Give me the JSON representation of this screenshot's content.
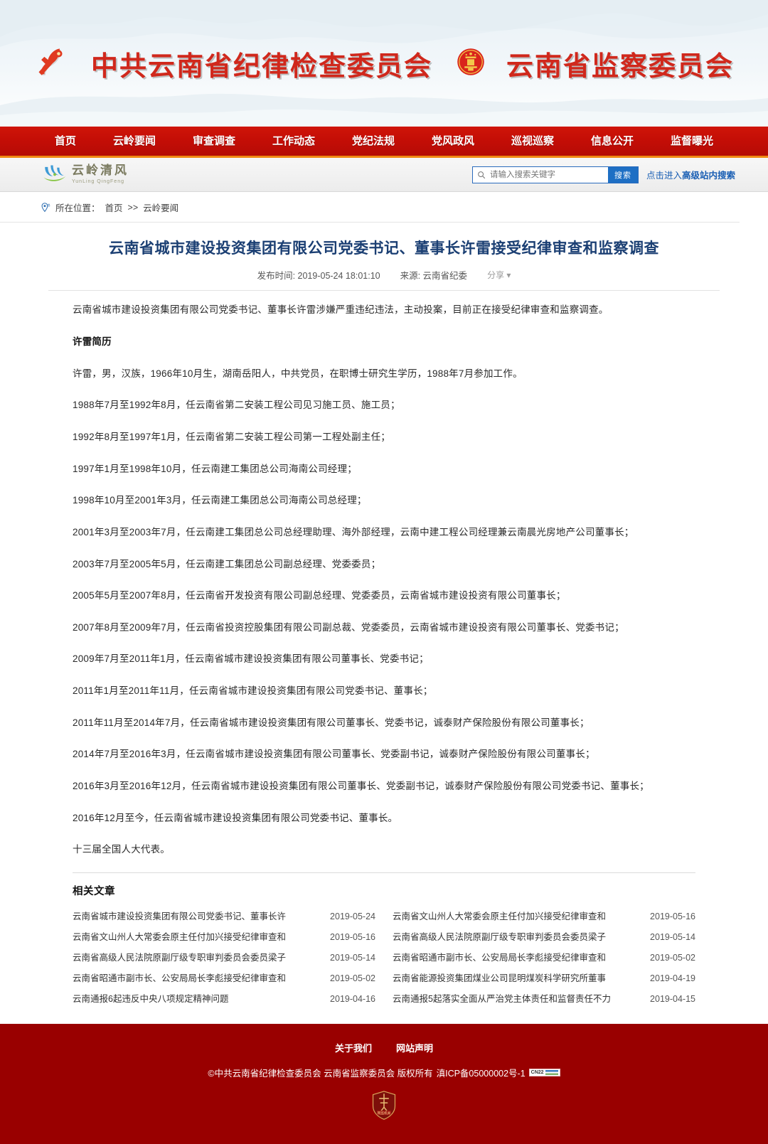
{
  "banner": {
    "party_emblem_icon": "hammer-sickle-emblem",
    "title_left": "中共云南省纪律检查委员会",
    "national_emblem_icon": "national-emblem",
    "title_right": "云南省监察委员会"
  },
  "nav": {
    "items": [
      {
        "label": "首页"
      },
      {
        "label": "云岭要闻"
      },
      {
        "label": "审查调查"
      },
      {
        "label": "工作动态"
      },
      {
        "label": "党纪法规"
      },
      {
        "label": "党风政风"
      },
      {
        "label": "巡视巡察"
      },
      {
        "label": "信息公开"
      },
      {
        "label": "监督曝光"
      }
    ]
  },
  "brand": {
    "logo_icon": "yunling-qingfeng-logo",
    "name_cn": "云岭清风",
    "name_en": "YunLing QingFeng"
  },
  "search": {
    "icon": "search-icon",
    "placeholder": "请输入搜索关键字",
    "value": "",
    "button_label": "搜索",
    "advanced_prefix": "点击进入",
    "advanced_strong": "高级站内搜索"
  },
  "breadcrumb": {
    "icon": "location-pin-icon",
    "label": "所在位置：",
    "home": "首页",
    "separator": ">>",
    "current": "云岭要闻"
  },
  "article": {
    "title": "云南省城市建设投资集团有限公司党委书记、董事长许雷接受纪律审查和监察调查",
    "publish_time": "发布时间: 2019-05-24 18:01:10",
    "source": "来源: 云南省纪委",
    "share": "分享 ▾",
    "paragraphs": [
      {
        "text": "云南省城市建设投资集团有限公司党委书记、董事长许雷涉嫌严重违纪违法，主动投案，目前正在接受纪律审查和监察调查。",
        "bold": false
      },
      {
        "text": "许雷简历",
        "bold": true
      },
      {
        "text": "许雷，男，汉族，1966年10月生，湖南岳阳人，中共党员，在职博士研究生学历，1988年7月参加工作。",
        "bold": false
      },
      {
        "text": "1988年7月至1992年8月，任云南省第二安装工程公司见习施工员、施工员；",
        "bold": false
      },
      {
        "text": "1992年8月至1997年1月，任云南省第二安装工程公司第一工程处副主任；",
        "bold": false
      },
      {
        "text": "1997年1月至1998年10月，任云南建工集团总公司海南公司经理；",
        "bold": false
      },
      {
        "text": "1998年10月至2001年3月，任云南建工集团总公司海南公司总经理；",
        "bold": false
      },
      {
        "text": "2001年3月至2003年7月，任云南建工集团总公司总经理助理、海外部经理，云南中建工程公司经理兼云南晨光房地产公司董事长；",
        "bold": false
      },
      {
        "text": "2003年7月至2005年5月，任云南建工集团总公司副总经理、党委委员；",
        "bold": false
      },
      {
        "text": "2005年5月至2007年8月，任云南省开发投资有限公司副总经理、党委委员，云南省城市建设投资有限公司董事长；",
        "bold": false
      },
      {
        "text": "2007年8月至2009年7月，任云南省投资控股集团有限公司副总裁、党委委员，云南省城市建设投资有限公司董事长、党委书记；",
        "bold": false
      },
      {
        "text": "2009年7月至2011年1月，任云南省城市建设投资集团有限公司董事长、党委书记；",
        "bold": false
      },
      {
        "text": "2011年1月至2011年11月，任云南省城市建设投资集团有限公司党委书记、董事长；",
        "bold": false
      },
      {
        "text": "2011年11月至2014年7月，任云南省城市建设投资集团有限公司董事长、党委书记，诚泰财产保险股份有限公司董事长；",
        "bold": false
      },
      {
        "text": "2014年7月至2016年3月，任云南省城市建设投资集团有限公司董事长、党委副书记，诚泰财产保险股份有限公司董事长；",
        "bold": false
      },
      {
        "text": "2016年3月至2016年12月，任云南省城市建设投资集团有限公司董事长、党委副书记，诚泰财产保险股份有限公司党委书记、董事长；",
        "bold": false
      },
      {
        "text": "2016年12月至今，任云南省城市建设投资集团有限公司党委书记、董事长。",
        "bold": false
      },
      {
        "text": "十三届全国人大代表。",
        "bold": false
      }
    ]
  },
  "related": {
    "heading": "相关文章",
    "items": [
      {
        "title": "云南省城市建设投资集团有限公司党委书记、董事长许",
        "date": "2019-05-24"
      },
      {
        "title": "云南省文山州人大常委会原主任付加兴接受纪律审查和",
        "date": "2019-05-16"
      },
      {
        "title": "云南省文山州人大常委会原主任付加兴接受纪律审查和",
        "date": "2019-05-16"
      },
      {
        "title": "云南省高级人民法院原副厅级专职审判委员会委员梁子",
        "date": "2019-05-14"
      },
      {
        "title": "云南省高级人民法院原副厅级专职审判委员会委员梁子",
        "date": "2019-05-14"
      },
      {
        "title": "云南省昭通市副市长、公安局局长李彪接受纪律审查和",
        "date": "2019-05-02"
      },
      {
        "title": "云南省昭通市副市长、公安局局长李彪接受纪律审查和",
        "date": "2019-05-02"
      },
      {
        "title": "云南省能源投资集团煤业公司昆明煤炭科学研究所董事",
        "date": "2019-04-19"
      },
      {
        "title": "云南通报6起违反中央八项规定精神问题",
        "date": "2019-04-16"
      },
      {
        "title": "云南通报5起落实全面从严治党主体责任和监督责任不力",
        "date": "2019-04-15"
      }
    ]
  },
  "footer": {
    "links": [
      {
        "label": "关于我们"
      },
      {
        "label": "网站声明"
      }
    ],
    "copyright": "©中共云南省纪律检查委员会 云南省监察委员会 版权所有",
    "icp": "滇ICP备05000002号-1",
    "icp_badge_text": "CN22",
    "shield_icon": "police-shield-badge",
    "shield_label": "网监机关"
  },
  "colors": {
    "nav_red": "#c30d06",
    "nav_border_orange": "#f08a13",
    "footer_red": "#990000",
    "title_navy": "#1b3f73",
    "link_blue": "#1a5fb4",
    "search_blue": "#1e6fc4",
    "emblem_red": "#d0281c"
  }
}
